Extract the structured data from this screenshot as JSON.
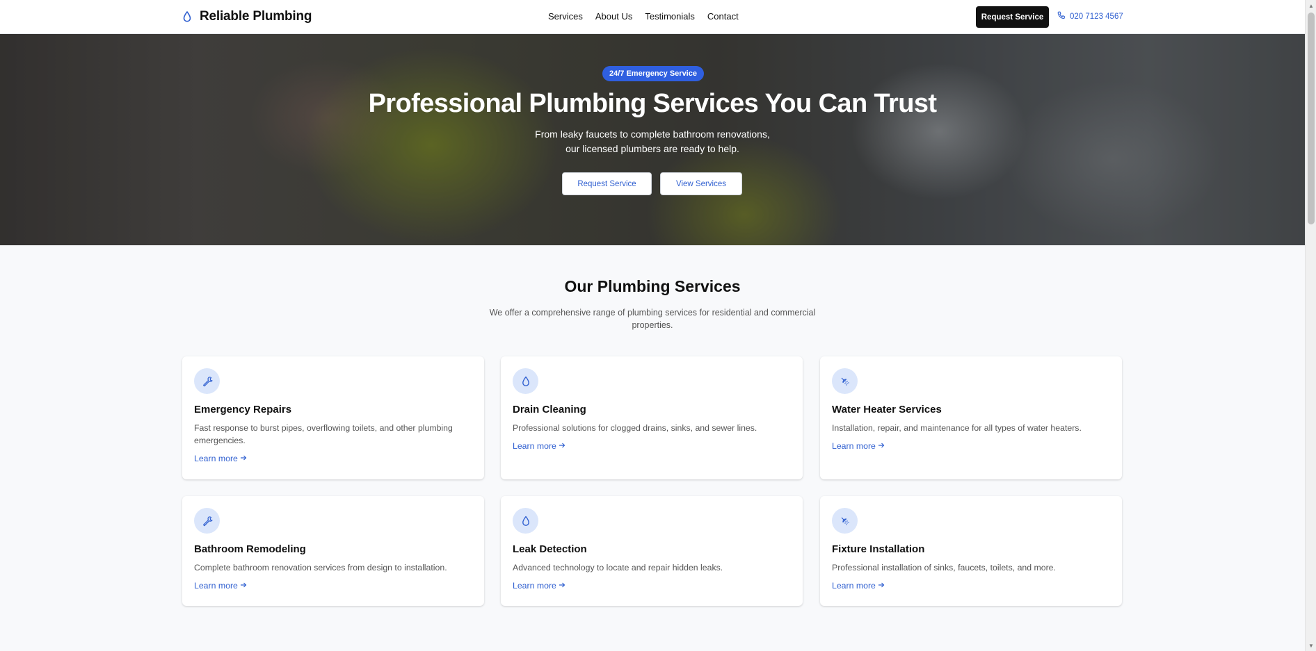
{
  "header": {
    "brand": "Reliable Plumbing",
    "brand_icon": "droplet-icon",
    "nav": [
      "Services",
      "About Us",
      "Testimonials",
      "Contact"
    ],
    "cta": "Request Service",
    "phone": "020 7123 4567",
    "phone_icon": "phone-icon"
  },
  "hero": {
    "badge": "24/7 Emergency Service",
    "title": "Professional Plumbing Services You Can Trust",
    "subtitle": "From leaky faucets to complete bathroom renovations, our licensed plumbers are ready to help.",
    "primary_button": "Request Service",
    "secondary_button": "View Services"
  },
  "services": {
    "title": "Our Plumbing Services",
    "subtitle": "We offer a comprehensive range of plumbing services for residential and commercial properties.",
    "items": [
      {
        "icon": "wrench-icon",
        "title": "Emergency Repairs",
        "desc": "Fast response to burst pipes, overflowing toilets, and other plumbing emergencies.",
        "link": "Learn more"
      },
      {
        "icon": "droplet-icon",
        "title": "Drain Cleaning",
        "desc": "Professional solutions for clogged drains, sinks, and sewer lines.",
        "link": "Learn more"
      },
      {
        "icon": "shower-icon",
        "title": "Water Heater Services",
        "desc": "Installation, repair, and maintenance for all types of water heaters.",
        "link": "Learn more"
      },
      {
        "icon": "wrench-icon",
        "title": "Bathroom Remodeling",
        "desc": "Complete bathroom renovation services from design to installation.",
        "link": "Learn more"
      },
      {
        "icon": "droplet-icon",
        "title": "Leak Detection",
        "desc": "Advanced technology to locate and repair hidden leaks.",
        "link": "Learn more"
      },
      {
        "icon": "shower-icon",
        "title": "Fixture Installation",
        "desc": "Professional installation of sinks, faucets, toilets, and more.",
        "link": "Learn more"
      }
    ]
  },
  "colors": {
    "accent": "#2f5fe0",
    "link": "#2f5fd0",
    "dark_button": "#111111",
    "icon_bg": "#dbe6fb"
  }
}
